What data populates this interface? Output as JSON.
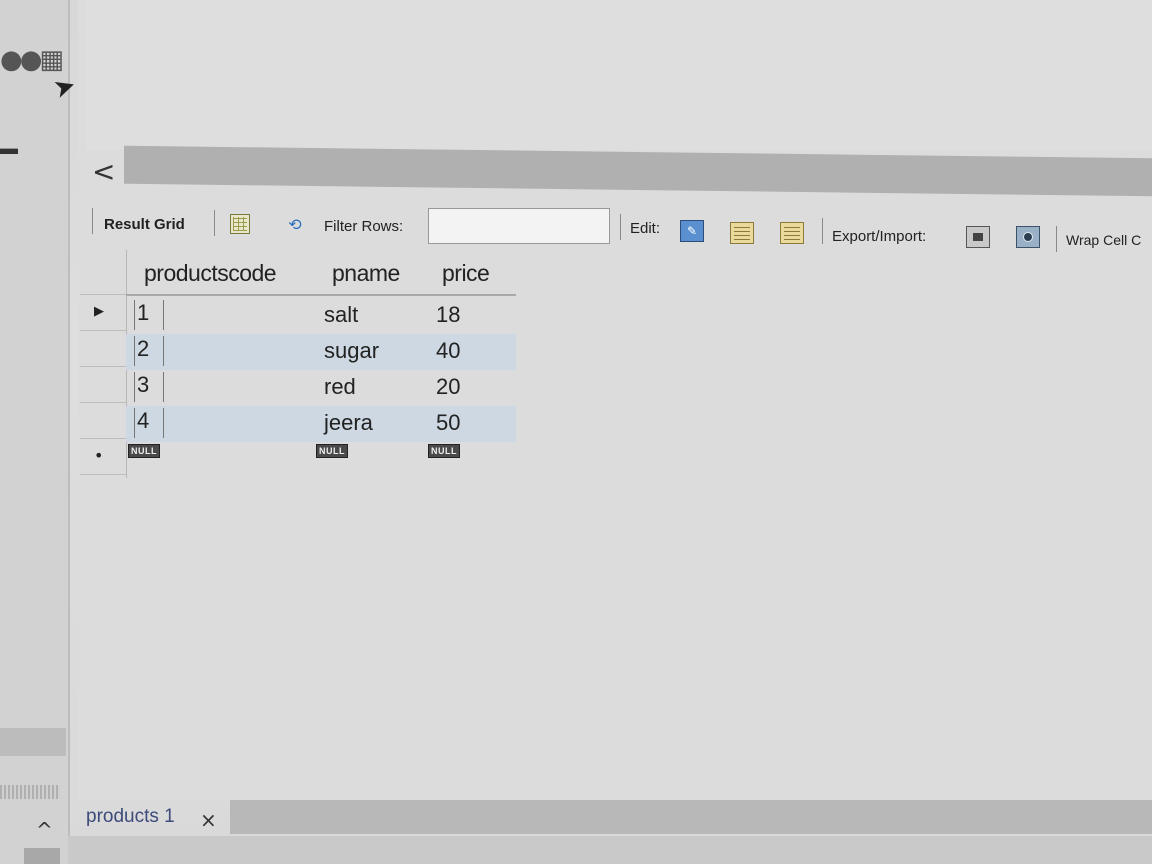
{
  "toolbar": {
    "result_grid_label": "Result Grid",
    "filter_rows_label": "Filter Rows:",
    "filter_rows_value": "",
    "edit_label": "Edit:",
    "export_import_label": "Export/Import:",
    "wrap_cell_label": "Wrap Cell C",
    "icons": [
      "grid-form-icon",
      "refresh-icon",
      "edit-row-icon",
      "add-row-icon",
      "delete-row-icon",
      "export-icon",
      "import-icon"
    ]
  },
  "grid": {
    "columns": [
      "productscode",
      "pname",
      "price"
    ],
    "rows": [
      {
        "productscode": "1",
        "pname": "salt",
        "price": "18"
      },
      {
        "productscode": "2",
        "pname": "sugar",
        "price": "40"
      },
      {
        "productscode": "3",
        "pname": "red",
        "price": "20"
      },
      {
        "productscode": "4",
        "pname": "jeera",
        "price": "50"
      }
    ],
    "new_row": {
      "productscode": "NULL",
      "pname": "NULL",
      "price": "NULL"
    },
    "current_row_indicator": "▶",
    "new_row_indicator": "•"
  },
  "bottom_tab": {
    "label": "products 1",
    "close": "×"
  },
  "nav": {
    "back": "<",
    "collapse_up": "^"
  },
  "colors": {
    "alt_row": "#cdd8e2",
    "tab_text": "#3d4b7a"
  }
}
